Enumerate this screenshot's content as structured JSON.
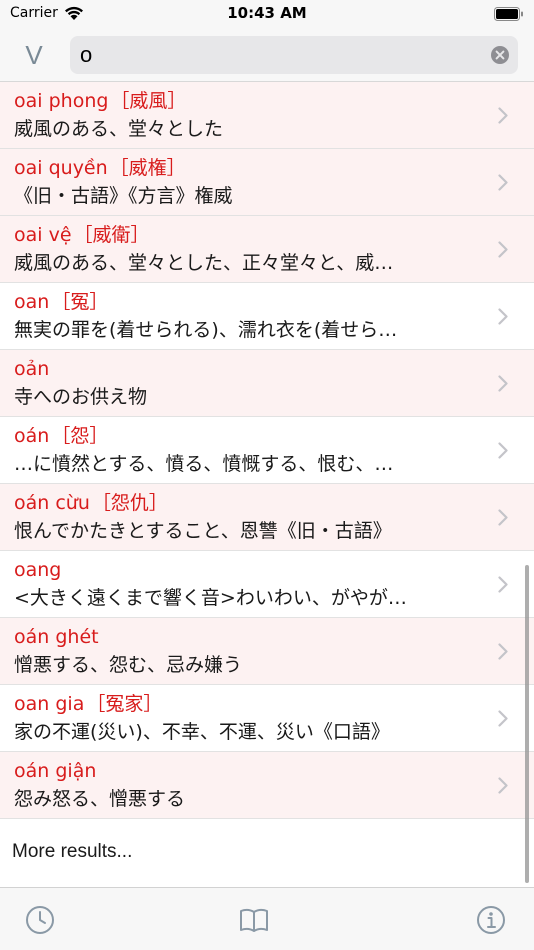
{
  "status_bar": {
    "carrier": "Carrier",
    "time": "10:43 AM"
  },
  "search": {
    "language_toggle": "V",
    "query": "o"
  },
  "results": [
    {
      "term": "oai phong",
      "kanji": "［威風］",
      "definition": "威風のある、堂々とした"
    },
    {
      "term": "oai quyền",
      "kanji": "［威権］",
      "definition": "《旧・古語》《方言》権威"
    },
    {
      "term": "oai vệ",
      "kanji": "［威衛］",
      "definition": "威風のある、堂々とした、正々堂々と、威…"
    },
    {
      "term": "oan",
      "kanji": "［冤］",
      "definition": "無実の罪を(着せられる)、濡れ衣を(着せら…"
    },
    {
      "term": "oản",
      "kanji": "",
      "definition": "寺へのお供え物"
    },
    {
      "term": "oán",
      "kanji": "［怨］",
      "definition": "…に憤然とする、憤る、憤慨する、恨む、…"
    },
    {
      "term": "oán cừu",
      "kanji": "［怨仇］",
      "definition": "恨んでかたきとすること、恩讐《旧・古語》"
    },
    {
      "term": "oang",
      "kanji": "",
      "definition": "<大きく遠くまで響く音>わいわい、がやが…"
    },
    {
      "term": "oán ghét",
      "kanji": "",
      "definition": "憎悪する、怨む、忌み嫌う"
    },
    {
      "term": "oan gia",
      "kanji": "［冤家］",
      "definition": "家の不運(災い)、不幸、不運、災い《口語》"
    },
    {
      "term": "oán giận",
      "kanji": "",
      "definition": "怨み怒る、憎悪する"
    }
  ],
  "more_results_label": "More results...",
  "colors": {
    "term": "#d81c1c",
    "alt_row": "#fdf2f2",
    "icon": "#8a99a6"
  },
  "tab_bar": {
    "icons": [
      "clock-icon",
      "book-icon",
      "info-icon"
    ]
  }
}
